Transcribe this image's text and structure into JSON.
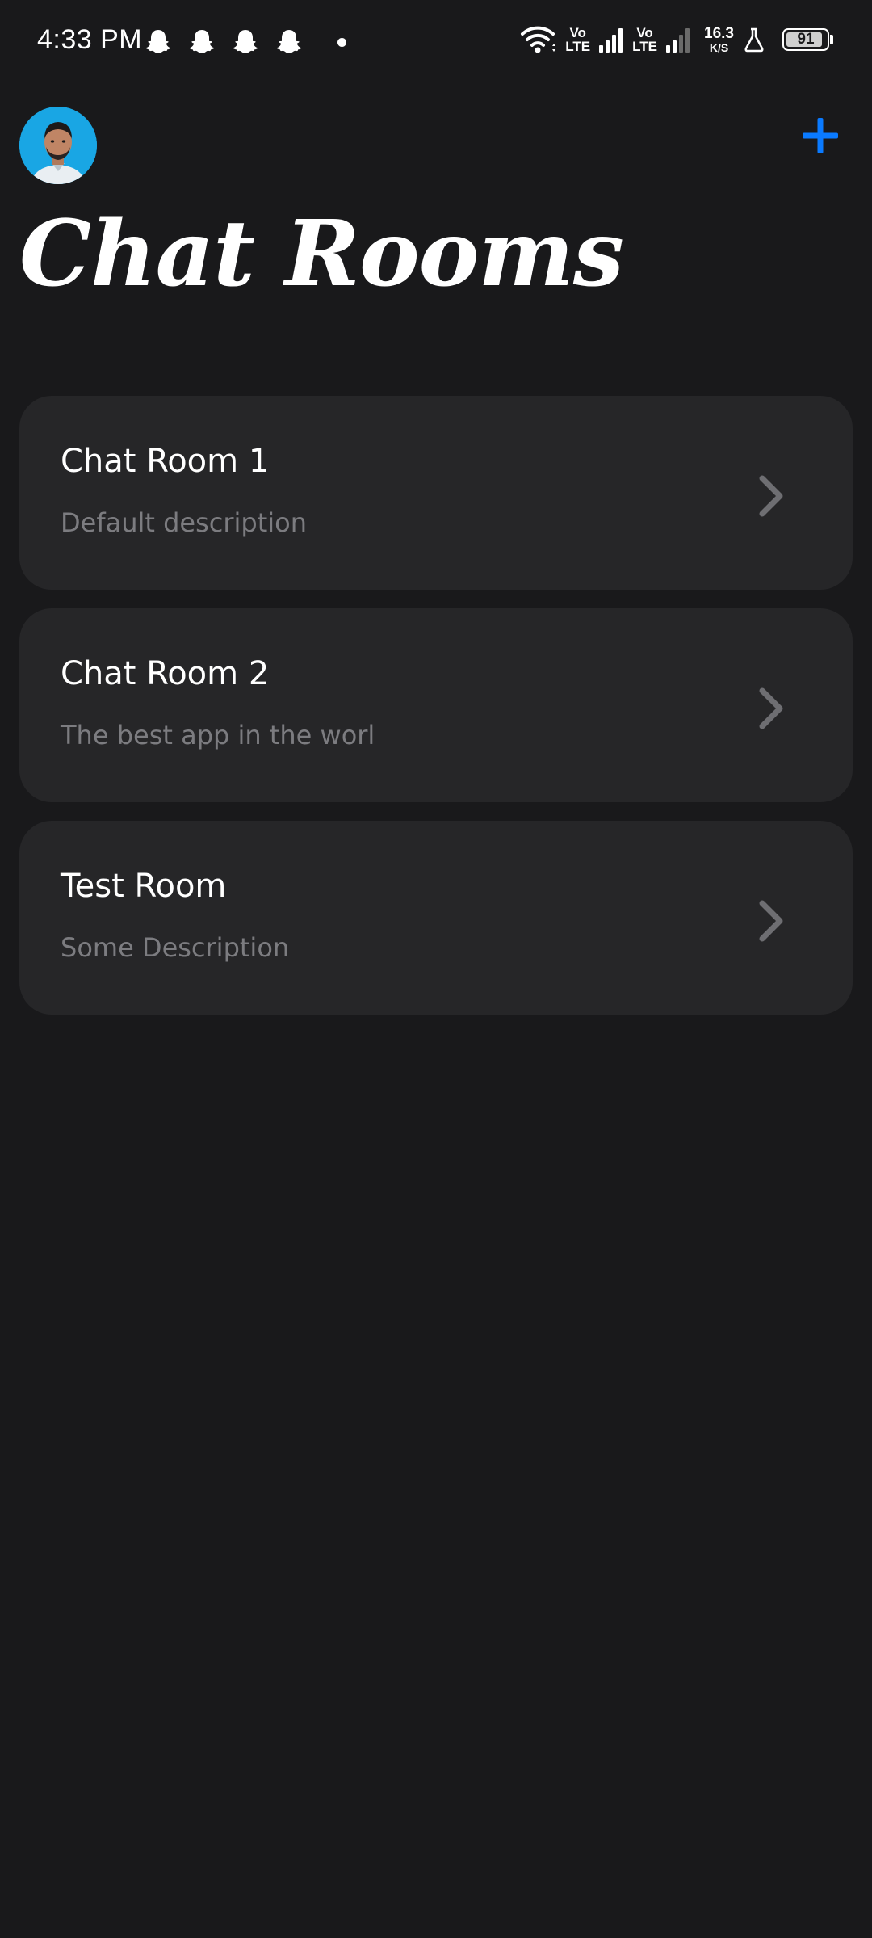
{
  "status_bar": {
    "time": "4:33 PM",
    "notification_icons": [
      "snapchat-icon",
      "snapchat-icon",
      "snapchat-icon",
      "snapchat-icon"
    ],
    "sim1_label_top": "Vo",
    "sim1_label_bottom": "LTE",
    "sim2_label_top": "Vo",
    "sim2_label_bottom": "LTE",
    "net_speed_value": "16.3",
    "net_speed_unit": "K/S",
    "battery_level": "91",
    "battery_fraction": 0.91
  },
  "header": {
    "title": "Chat Rooms",
    "add_icon": "plus-icon",
    "accent_color": "#0a7aff"
  },
  "rooms": [
    {
      "name": "Chat Room 1",
      "description": "Default description"
    },
    {
      "name": "Chat Room 2",
      "description": "The best app in the worl"
    },
    {
      "name": "Test Room",
      "description": "Some Description"
    }
  ],
  "colors": {
    "background": "#19191b",
    "card": "#262628",
    "secondary_text": "#7c7c80",
    "chevron": "#6e6e72"
  }
}
